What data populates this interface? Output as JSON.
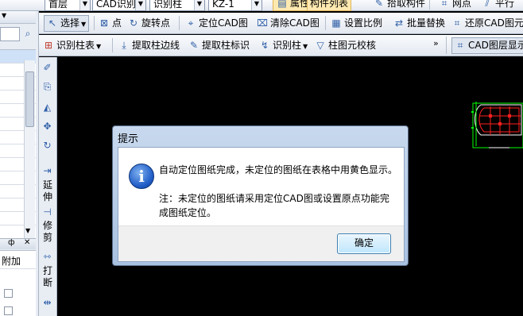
{
  "toolbar1": {
    "floor_combo": "首层",
    "type_combo": "CAD识别",
    "element_combo": "识别柱",
    "id_combo": "KZ-1",
    "props_btn": "属性",
    "list_btn": "构件列表",
    "pick_btn": "拾取构件",
    "grid_btn": "网点",
    "parallel_btn": "平行"
  },
  "toolbar2": {
    "select_btn": "选择",
    "point_btn": "点",
    "rotate_point_btn": "旋转点",
    "locate_cad_btn": "定位CAD图",
    "clear_cad_btn": "清除CAD图",
    "set_scale_btn": "设置比例",
    "batch_replace_btn": "批量替换",
    "restore_cad_btn": "还原CAD图元"
  },
  "toolbar3": {
    "identify_table_btn": "识别柱表",
    "extract_edge_btn": "提取柱边线",
    "extract_label_btn": "提取柱标识",
    "identify_column_btn": "识别柱",
    "check_btn": "柱图元校核",
    "more": "»",
    "cad_layer_btn": "CAD图层显示"
  },
  "left_panel": {
    "panel_pin": "ф",
    "panel_close": "✕",
    "column_header": "附加"
  },
  "vertical_tools": {
    "extend": "延伸",
    "trim": "修剪",
    "break": "打断"
  },
  "dialog": {
    "title": "提示",
    "message_line1": "自动定位图纸完成，未定位的图纸在表格中用黄色显示。",
    "message_line2": "注：未定位的图纸请采用定位CAD图或设置原点功能完成图纸定位。",
    "ok_label": "确定"
  },
  "colors": {
    "canvas_bg": "#000000",
    "toolbar_bg": "#e8edf4",
    "dialog_frame": "#b4cbe8",
    "cad_green": "#00ff00",
    "cad_red": "#ff2020"
  }
}
